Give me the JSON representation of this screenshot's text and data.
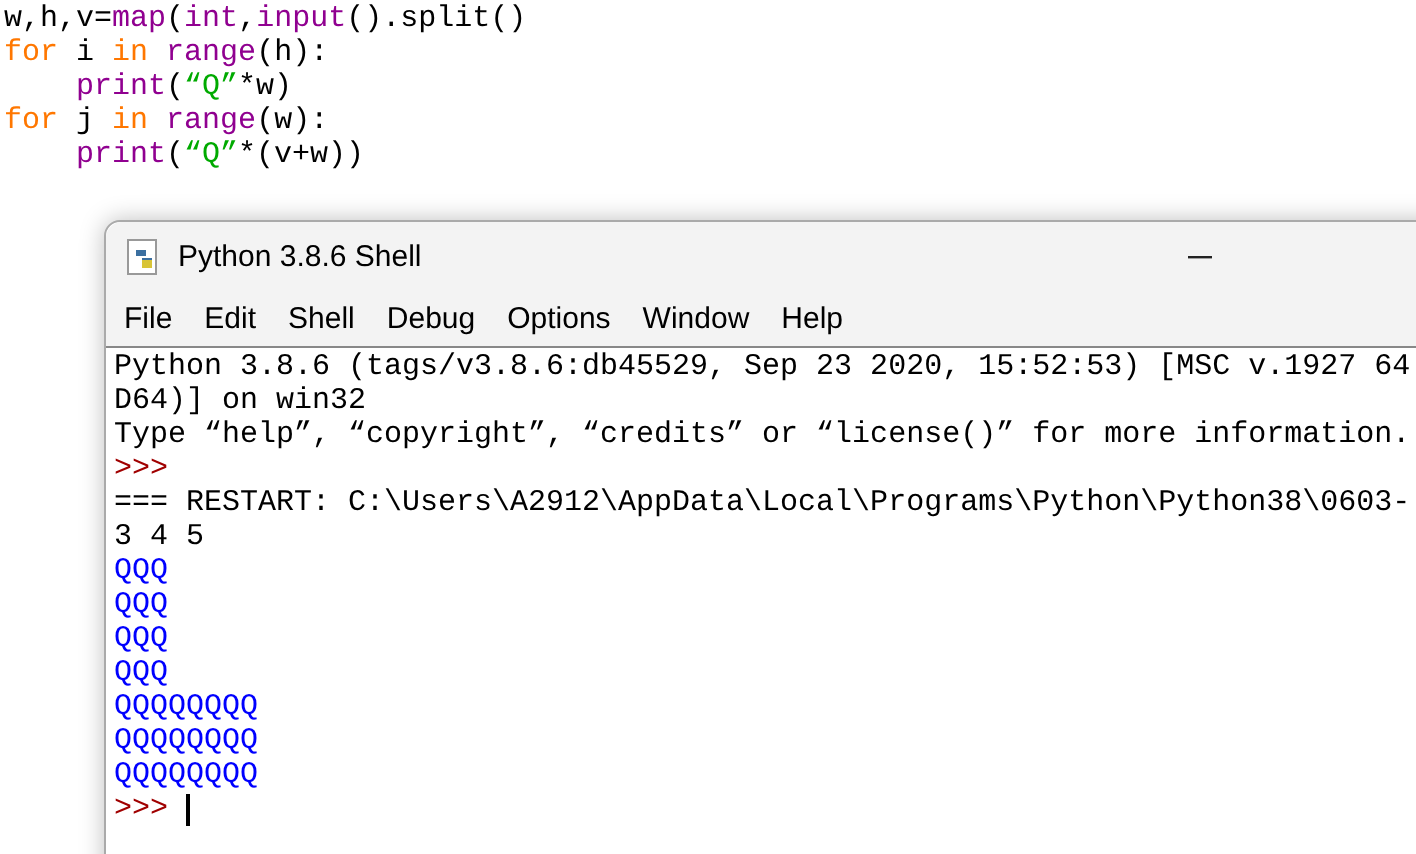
{
  "editor": {
    "lines": [
      [
        {
          "kind": "plain",
          "text": "w,h,v="
        },
        {
          "kind": "builtin",
          "text": "map"
        },
        {
          "kind": "plain",
          "text": "("
        },
        {
          "kind": "builtin",
          "text": "int"
        },
        {
          "kind": "plain",
          "text": ","
        },
        {
          "kind": "builtin",
          "text": "input"
        },
        {
          "kind": "plain",
          "text": "().split()"
        }
      ],
      [
        {
          "kind": "keyword",
          "text": "for"
        },
        {
          "kind": "plain",
          "text": " i "
        },
        {
          "kind": "keyword",
          "text": "in"
        },
        {
          "kind": "builtin",
          "text": " range"
        },
        {
          "kind": "plain",
          "text": "(h):"
        }
      ],
      [
        {
          "kind": "builtin",
          "text": "    print"
        },
        {
          "kind": "plain",
          "text": "("
        },
        {
          "kind": "string",
          "text": "“Q”"
        },
        {
          "kind": "plain",
          "text": "*w)"
        }
      ],
      [
        {
          "kind": "keyword",
          "text": "for"
        },
        {
          "kind": "plain",
          "text": " j "
        },
        {
          "kind": "keyword",
          "text": "in"
        },
        {
          "kind": "builtin",
          "text": " range"
        },
        {
          "kind": "plain",
          "text": "(w):"
        }
      ],
      [
        {
          "kind": "builtin",
          "text": "    print"
        },
        {
          "kind": "plain",
          "text": "("
        },
        {
          "kind": "string",
          "text": "“Q”"
        },
        {
          "kind": "plain",
          "text": "*(v+w))"
        }
      ]
    ]
  },
  "window": {
    "title": "Python 3.8.6 Shell",
    "menu": [
      "File",
      "Edit",
      "Shell",
      "Debug",
      "Options",
      "Window",
      "Help"
    ],
    "shell_lines": [
      {
        "kind": "output",
        "text": "Python 3.8.6 (tags/v3.8.6:db45529, Sep 23 2020, 15:52:53) [MSC v.1927 64"
      },
      {
        "kind": "output",
        "text": "D64)] on win32"
      },
      {
        "kind": "output",
        "text": "Type “help”, “copyright”, “credits” or “license()” for more information."
      },
      {
        "kind": "prompt",
        "text": ">>>"
      },
      {
        "kind": "output",
        "text": "=== RESTART: C:\\Users\\A2912\\AppData\\Local\\Programs\\Python\\Python38\\0603-"
      },
      {
        "kind": "output",
        "text": "3 4 5"
      },
      {
        "kind": "stdout",
        "text": "QQQ"
      },
      {
        "kind": "stdout",
        "text": "QQQ"
      },
      {
        "kind": "stdout",
        "text": "QQQ"
      },
      {
        "kind": "stdout",
        "text": "QQQ"
      },
      {
        "kind": "stdout",
        "text": "QQQQQQQQ"
      },
      {
        "kind": "stdout",
        "text": "QQQQQQQQ"
      },
      {
        "kind": "stdout",
        "text": "QQQQQQQQ"
      },
      {
        "kind": "prompt",
        "text": ">>>",
        "cursor": true
      }
    ]
  }
}
